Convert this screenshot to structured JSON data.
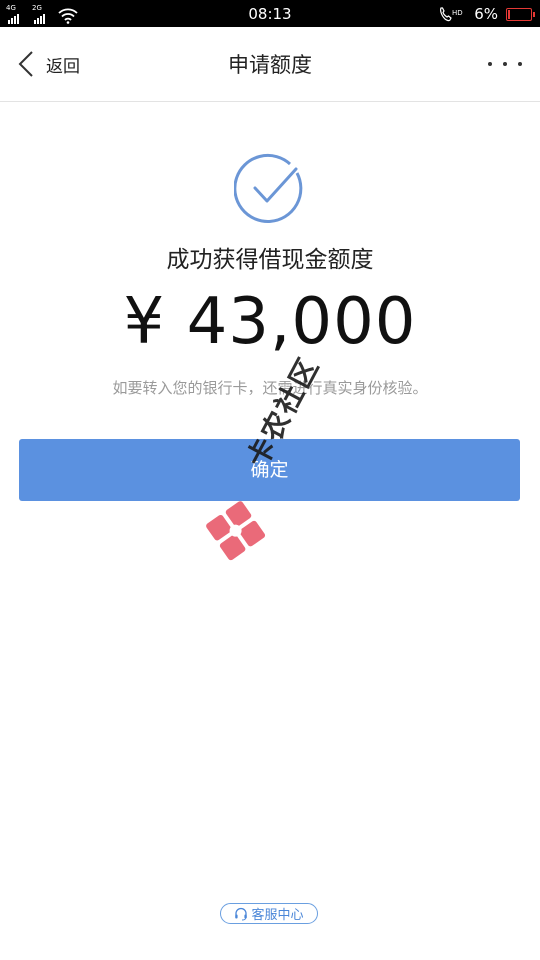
{
  "status_bar": {
    "sim1_network": "4G",
    "sim2_network": "2G",
    "time": "08:13",
    "battery_percent": "6%",
    "battery_level": 0.06,
    "battery_color": "#e53935",
    "icons": [
      "signal-icon",
      "wifi-icon",
      "phone-hd-icon",
      "battery-icon"
    ]
  },
  "navbar": {
    "back_label": "返回",
    "title": "申请额度",
    "more_icon": "more-dots-icon"
  },
  "main": {
    "icon": "check-circle-icon",
    "success_text": "成功获得借现金额度",
    "amount": "¥ 43,000",
    "hint": "如要转入您的银行卡，还需进行真实身份核验。",
    "confirm_label": "确定"
  },
  "watermark": {
    "text": "卡农社区"
  },
  "footer": {
    "service_label": "客服中心",
    "service_icon": "headset-icon"
  },
  "colors": {
    "accent": "#5b91e0",
    "service_blue": "#4a86d8",
    "hint_gray": "#9a9a9a",
    "check_blue": "#6b96d6"
  }
}
